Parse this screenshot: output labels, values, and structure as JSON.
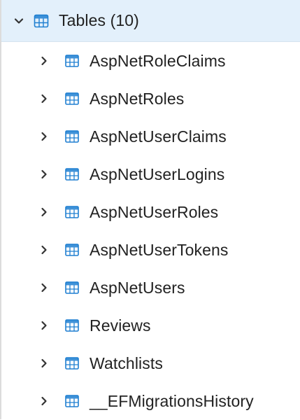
{
  "tree": {
    "root": {
      "label": "Tables (10)",
      "expanded": true,
      "icon": "tables-icon"
    },
    "items": [
      {
        "label": "AspNetRoleClaims"
      },
      {
        "label": "AspNetRoles"
      },
      {
        "label": "AspNetUserClaims"
      },
      {
        "label": "AspNetUserLogins"
      },
      {
        "label": "AspNetUserRoles"
      },
      {
        "label": "AspNetUserTokens"
      },
      {
        "label": "AspNetUsers"
      },
      {
        "label": "Reviews"
      },
      {
        "label": "Watchlists"
      },
      {
        "label": "__EFMigrationsHistory"
      }
    ]
  },
  "colors": {
    "accent": "#1f7fd1",
    "selection": "#e3f0fb",
    "text": "#222222"
  }
}
